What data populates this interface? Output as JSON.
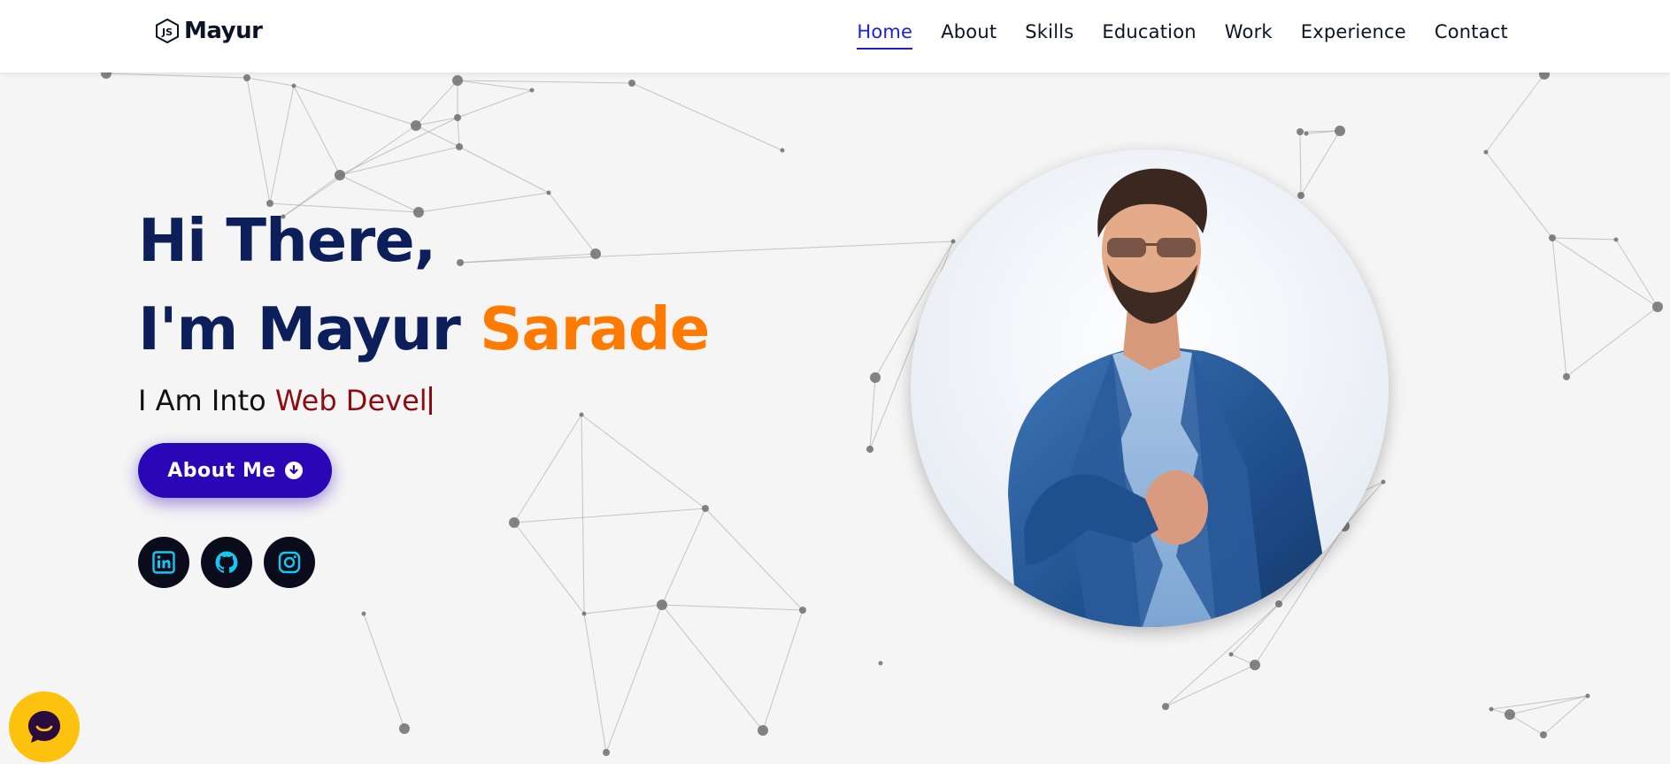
{
  "header": {
    "logo_text": "Mayur",
    "nav": [
      {
        "label": "Home",
        "active": true
      },
      {
        "label": "About",
        "active": false
      },
      {
        "label": "Skills",
        "active": false
      },
      {
        "label": "Education",
        "active": false
      },
      {
        "label": "Work",
        "active": false
      },
      {
        "label": "Experience",
        "active": false
      },
      {
        "label": "Contact",
        "active": false
      }
    ]
  },
  "hero": {
    "greeting": "Hi There,",
    "intro_prefix": "I'm Mayur ",
    "intro_accent": "Sarade",
    "typed_prefix": "I Am Into ",
    "typed_text": "Web Devel",
    "button_label": "About Me"
  },
  "socials": [
    {
      "name": "linkedin",
      "icon": "linkedin-icon"
    },
    {
      "name": "github",
      "icon": "github-icon"
    },
    {
      "name": "instagram",
      "icon": "instagram-icon"
    }
  ],
  "portrait": {
    "icon": "profile-photo"
  },
  "chat": {
    "icon": "chat-icon"
  },
  "colors": {
    "navy": "#0c1f5a",
    "accent": "#ff7a00",
    "typed": "#8b0d12",
    "button": "#2a07b6",
    "nav_active": "#1f1fd6",
    "social_bg": "#0a0c1c",
    "social_icon": "#15c8f0",
    "chat_bg": "#fcc20e"
  }
}
